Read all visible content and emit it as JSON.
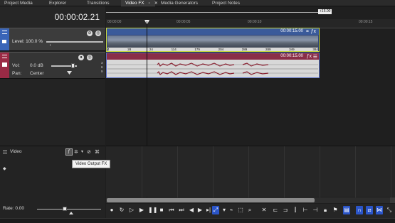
{
  "tabs": [
    {
      "label": "Project Media"
    },
    {
      "label": "Explorer"
    },
    {
      "label": "Transitions"
    },
    {
      "label": "Video FX"
    },
    {
      "label": "Media Generators"
    },
    {
      "label": "Project Notes"
    }
  ],
  "timecode": "00:00:02.21",
  "loop_marker": "+15.00",
  "ruler_labels": [
    "00:00:00",
    "00:00:05",
    "00:00:10",
    "00:00:15"
  ],
  "video_track": {
    "level_label": "Level: 100.0 %",
    "level": 1.0,
    "clip_duration": "00:00:15.00",
    "frame_labels": [
      "4",
      "28",
      "24",
      "114",
      "179",
      "204",
      "289",
      "289",
      "349",
      "384"
    ]
  },
  "audio_track": {
    "vol_label": "Vol:",
    "vol_value": "0.0 dB",
    "pan_label": "Pan:",
    "pan_value": "Center",
    "clip_duration": "00:00:15.00",
    "channel_labels": [
      "3",
      "6",
      "9"
    ]
  },
  "bus": {
    "video_label": "Video",
    "rate_label": "Rate: 0.00"
  },
  "tooltip": "Video Output FX",
  "colors": {
    "video_strip": "#3a65b8",
    "audio_strip": "#9a2a45",
    "video_clip": "#30467a",
    "audio_clip": "#8a2e48",
    "clip_border": "#c8d840",
    "accent_blue": "#2b55c8"
  },
  "icons": {
    "transport": [
      "record-icon",
      "loop-icon",
      "play-from-start-icon",
      "play-icon",
      "pause-icon",
      "stop-icon",
      "go-to-start-icon",
      "go-to-end-icon",
      "previous-frame-icon",
      "next-frame-icon",
      "go-to-end2-icon",
      "normal-edit-tool-icon",
      "dropdown-icon",
      "envelope-tool-icon",
      "selection-tool-icon",
      "zoom-tool-icon",
      "delete-icon",
      "trim-start-icon",
      "trim-end-icon",
      "split-icon",
      "lock-icon",
      "marker-icon",
      "region-icon",
      "snap-icon",
      "auto-ripple-icon",
      "crossfade-icon"
    ]
  }
}
